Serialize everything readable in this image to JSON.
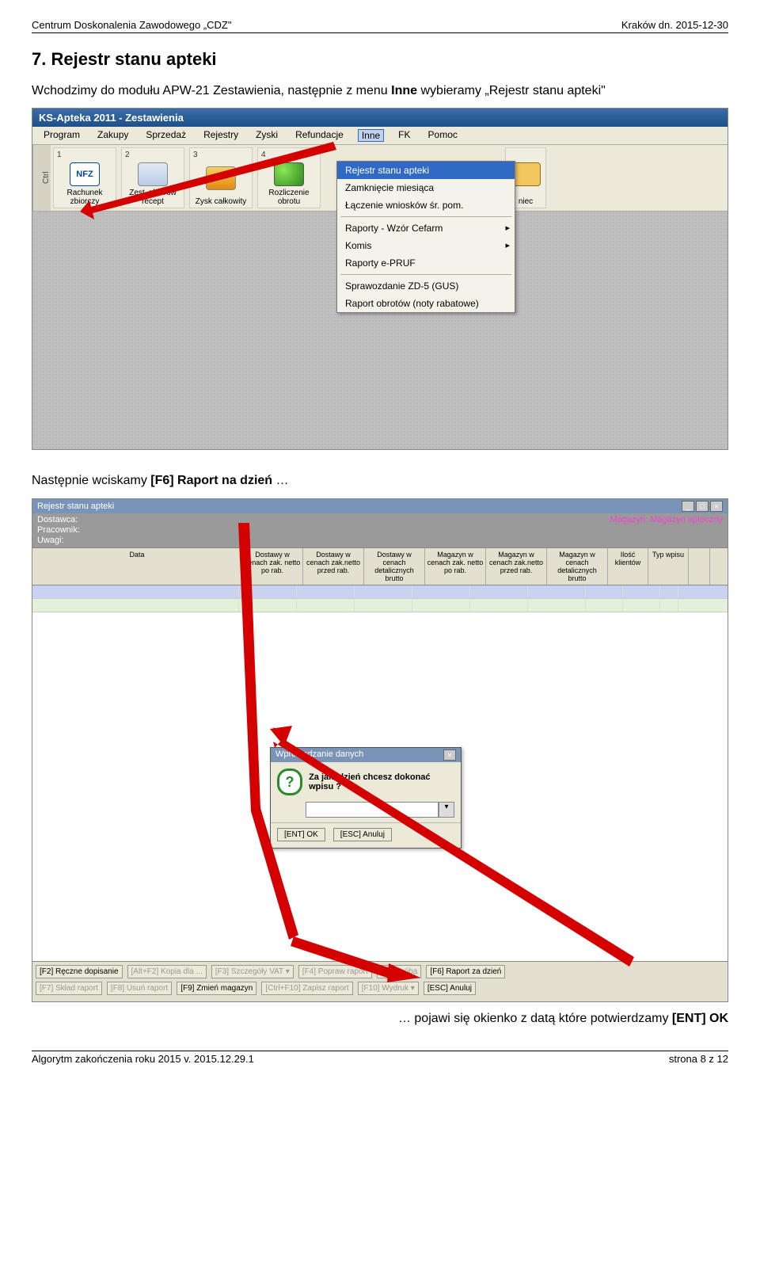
{
  "doc": {
    "header_left": "Centrum Doskonalenia Zawodowego „CDZ\"",
    "header_right": "Kraków dn. 2015-12-30",
    "section_title": "7. Rejestr stanu apteki",
    "para1_pre": "Wchodzimy do modułu APW-21 Zestawienia, następnie z menu ",
    "para1_bold": "Inne",
    "para1_post": " wybieramy „Rejestr stanu apteki\"",
    "para2_pre": "Następnie wciskamy ",
    "para2_bold": "[F6] Raport na dzień",
    "para2_post": " …",
    "para3_pre": "… pojawi się okienko z datą które potwierdzamy ",
    "para3_bold": "[ENT] OK",
    "footer_left": "Algorytm zakończenia roku 2015   v. 2015.12.29.1",
    "footer_right": "strona 8 z 12"
  },
  "shot1": {
    "title": "KS-Apteka 2011 - Zestawienia",
    "menu": [
      "Program",
      "Zakupy",
      "Sprzedaż",
      "Rejestry",
      "Zyski",
      "Refundacje",
      "Inne",
      "FK",
      "Pomoc"
    ],
    "ctrl": "Ctrl",
    "tools": [
      {
        "num": "1",
        "label": "Rachunek zbiorczy",
        "icon": "nfz",
        "nfz": "NFZ"
      },
      {
        "num": "2",
        "label": "Zest. zbiorów recept",
        "icon": "doc"
      },
      {
        "num": "3",
        "label": "Zysk całkowity",
        "icon": "bars"
      },
      {
        "num": "4",
        "label": "Rozliczenie obrotu",
        "icon": "coins"
      },
      {
        "num": "",
        "label": "niec",
        "icon": "folder"
      }
    ],
    "dropdown": [
      {
        "t": "Rejestr stanu apteki",
        "sel": true
      },
      {
        "t": "Zamknięcie miesiąca"
      },
      {
        "t": "Łączenie wniosków śr. pom."
      },
      {
        "sep": true
      },
      {
        "t": "Raporty - Wzór Cefarm",
        "sub": true
      },
      {
        "t": "Komis",
        "sub": true
      },
      {
        "t": "Raporty e-PRUF"
      },
      {
        "sep": true
      },
      {
        "t": "Sprawozdanie ZD-5 (GUS)"
      },
      {
        "t": "Raport obrotów (noty rabatowe)"
      }
    ]
  },
  "shot2": {
    "title": "Rejestr stanu apteki",
    "info_rows": [
      "Dostawca:",
      "Pracownik:",
      "Uwagi:"
    ],
    "mag_label": "Magazyn: ",
    "mag_value": "Magazyn apteczny",
    "head": [
      "Data",
      "Dostawy w cenach zak. netto po rab.",
      "Dostawy w cenach zak.netto przed rab.",
      "Dostawy w cenach detalicznych brutto",
      "Magazyn w cenach zak. netto po rab.",
      "Magazyn w cenach zak.netto przed rab.",
      "Magazyn w cenach detalicznych brutto",
      "Ilość klientów",
      "Typ wpisu"
    ],
    "dlg_title": "Wprowadzanie danych",
    "dlg_q": "Za jaki dzień chcesz dokonać wpisu ?",
    "dlg_ok": "[ENT] OK",
    "dlg_cancel": "[ESC] Anuluj",
    "foot_row1": [
      "[F2] Ręczne dopisanie",
      "[Alt+F2] Kopia dla ...",
      "[F3] Szczegóły VAT ▾",
      "[F4] Popraw raport",
      "[F5] Próba",
      "[F6] Raport za dzień"
    ],
    "foot_row2": [
      "[F7] Skład raport",
      "[F8] Usuń raport",
      "[F9] Zmień magazyn",
      "[Ctrl+F10] Zapisz raport",
      "[F10] Wydruk ▾",
      "[ESC] Anuluj"
    ],
    "foot_disabled": [
      1,
      2,
      3,
      4,
      0,
      1,
      3,
      4
    ]
  }
}
